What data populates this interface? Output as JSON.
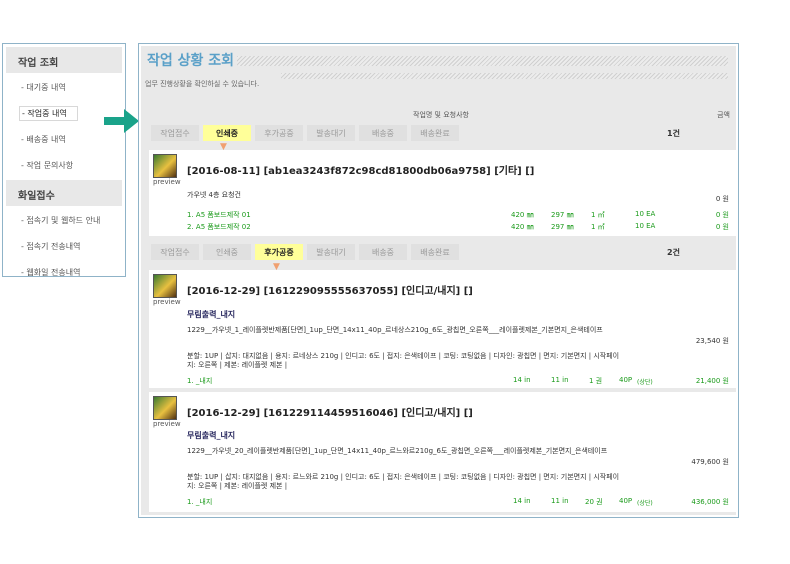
{
  "sidebar": {
    "sec1": "작업 조회",
    "items1": [
      "- 대기중 내역",
      "- 작업중 내역",
      "- 배송중 내역",
      "- 작업 문의사항"
    ],
    "sec2": "화일접수",
    "items2": [
      "- 접속기 및 웹하드 안내",
      "- 접속기 전송내역",
      "- 웹화일 전송내역"
    ]
  },
  "header": {
    "title": "작업 상황 조회",
    "subtitle": "업무 진행상황을 확인하실 수 있습니다.",
    "col_work": "작업명 및 요청사항",
    "col_amount": "금액"
  },
  "steps": [
    "작업접수",
    "인쇄중",
    "후가공중",
    "발송대기",
    "배송중",
    "배송완료"
  ],
  "group1": {
    "active_step": "인쇄중",
    "count": "1건",
    "job": {
      "title": "[2016-08-11] [ab1ea3243f872c98cd81800db06a9758] [기타] []",
      "preview": "preview",
      "request": "가우넷 4층 요청건",
      "request_amount": "0 원",
      "items": [
        {
          "name": "1. A5 폼보드제작 01",
          "w": "420 ㎜",
          "h": "297 ㎜",
          "q": "1 ㎡",
          "ea": "10 EA",
          "price": "0 원"
        },
        {
          "name": "2. A5 폼보드제작 02",
          "w": "420 ㎜",
          "h": "297 ㎜",
          "q": "1 ㎡",
          "ea": "10 EA",
          "price": "0 원"
        }
      ]
    }
  },
  "group2": {
    "active_step": "후가공중",
    "count": "2건",
    "jobs": [
      {
        "title": "[2016-12-29] [161229095555637055] [인디고/내지] []",
        "preview": "preview",
        "product": "무림출력_내지",
        "desc": "1229__가우넷_1_레이플렛반제품[단면]_1up_단면_14x11_40p_르네상스210g_6도_광칩면_오른쪽___레이플렛제본_기본면지_은색테이프",
        "desc_amount": "23,540 원",
        "options": "분할: 1UP | 삽지: 대지없음 | 용지: 르네상스 210g | 인디고: 6도 | 접지: 은색테이프 | 코팅: 코팅없음 | 디자인: 광칩면 | 면지: 기본면지 | 시작페이지: 오른쪽 | 제본: 레이플렛 제본 |",
        "item": {
          "name": "1. _내지",
          "w": "14 in",
          "h": "11 in",
          "q": "1 권",
          "p": "40P",
          "note": "(상단)",
          "price": "21,400 원"
        }
      },
      {
        "title": "[2016-12-29] [161229114459516046] [인디고/내지] []",
        "preview": "preview",
        "product": "무림출력_내지",
        "desc": "1229__가우넷_20_레이플렛반제품[단면]_1up_단면_14x11_40p_르느와르210g_6도_광칩면_오른쪽___레이플렛제본_기본면지_은색테이프",
        "desc_amount": "479,600 원",
        "options": "분할: 1UP | 삽지: 대지없음 | 용지: 르느와르 210g | 인디고: 6도 | 접지: 은색테이프 | 코팅: 코팅없음 | 디자인: 광칩면 | 면지: 기본면지 | 시작페이지: 오른쪽 | 제본: 레이플렛 제본 |",
        "item": {
          "name": "1. _내지",
          "w": "14 in",
          "h": "11 in",
          "q": "20 권",
          "p": "40P",
          "note": "(상단)",
          "price": "436,000 원"
        }
      }
    ]
  },
  "colors": {
    "accent": "#5aa0c8",
    "arrow": "#1aa38a",
    "highlight": "#ffff99",
    "green": "#1a9a1a"
  }
}
